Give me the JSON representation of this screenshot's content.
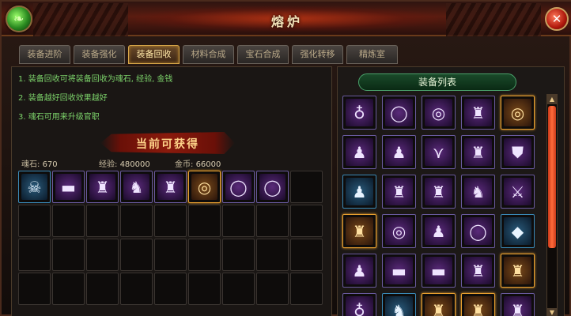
{
  "window": {
    "title": "熔炉",
    "close_label": "✕",
    "orb_glyph": "❧"
  },
  "tabs": [
    "装备进阶",
    "装备强化",
    "装备回收",
    "材料合成",
    "宝石合成",
    "强化转移",
    "精炼室"
  ],
  "active_tab": 2,
  "tips": [
    "1. 装备回收可将装备回收为魂石, 经验, 金钱",
    "2. 装备越好回收效果越好",
    "3. 魂石可用来升级官职"
  ],
  "banner": "当前可获得",
  "stats": {
    "soul": {
      "label": "魂石:",
      "value": "670"
    },
    "exp": {
      "label": "经验:",
      "value": "480000"
    },
    "gold": {
      "label": "金币:",
      "value": "66000"
    }
  },
  "recycle_items": [
    {
      "icon": "skull-necklace-icon",
      "glyph": "☠",
      "quality": "blue"
    },
    {
      "icon": "belt-icon",
      "glyph": "▬",
      "quality": "purple"
    },
    {
      "icon": "armor-icon",
      "glyph": "♜",
      "quality": "purple"
    },
    {
      "icon": "helmet-icon",
      "glyph": "♞",
      "quality": "purple"
    },
    {
      "icon": "armor-icon",
      "glyph": "♜",
      "quality": "purple"
    },
    {
      "icon": "ring-icon",
      "glyph": "◎",
      "quality": "gold"
    },
    {
      "icon": "bracelet-icon",
      "glyph": "◯",
      "quality": "purple"
    },
    {
      "icon": "bracelet-icon",
      "glyph": "◯",
      "quality": "purple"
    }
  ],
  "recycle_slots_total": 36,
  "list_title": "装备列表",
  "equipment_list": [
    {
      "icon": "necklace-icon",
      "glyph": "♁",
      "quality": "purple"
    },
    {
      "icon": "bracelet-icon",
      "glyph": "◯",
      "quality": "purple"
    },
    {
      "icon": "ring-icon",
      "glyph": "◎",
      "quality": "purple"
    },
    {
      "icon": "armor-icon",
      "glyph": "♜",
      "quality": "purple"
    },
    {
      "icon": "ring-icon",
      "glyph": "◎",
      "quality": "gold"
    },
    {
      "icon": "boots-icon",
      "glyph": "♟",
      "quality": "purple"
    },
    {
      "icon": "boots-icon",
      "glyph": "♟",
      "quality": "purple"
    },
    {
      "icon": "rank-badge-icon",
      "glyph": "⋎",
      "quality": "purple"
    },
    {
      "icon": "armor-icon",
      "glyph": "♜",
      "quality": "purple"
    },
    {
      "icon": "badge-icon",
      "glyph": "⛊",
      "quality": "purple"
    },
    {
      "icon": "boots-icon",
      "glyph": "♟",
      "quality": "blue"
    },
    {
      "icon": "armor-icon",
      "glyph": "♜",
      "quality": "purple"
    },
    {
      "icon": "armor-icon",
      "glyph": "♜",
      "quality": "purple"
    },
    {
      "icon": "helmet-icon",
      "glyph": "♞",
      "quality": "purple"
    },
    {
      "icon": "sword-icon",
      "glyph": "⚔",
      "quality": "purple"
    },
    {
      "icon": "armor-icon",
      "glyph": "♜",
      "quality": "gold"
    },
    {
      "icon": "ring-icon",
      "glyph": "◎",
      "quality": "purple"
    },
    {
      "icon": "boots-icon",
      "glyph": "♟",
      "quality": "purple"
    },
    {
      "icon": "bracelet-icon",
      "glyph": "◯",
      "quality": "purple"
    },
    {
      "icon": "gem-icon",
      "glyph": "◆",
      "quality": "blue"
    },
    {
      "icon": "boots-icon",
      "glyph": "♟",
      "quality": "purple"
    },
    {
      "icon": "belt-icon",
      "glyph": "▬",
      "quality": "purple"
    },
    {
      "icon": "belt-icon",
      "glyph": "▬",
      "quality": "purple"
    },
    {
      "icon": "armor-icon",
      "glyph": "♜",
      "quality": "purple"
    },
    {
      "icon": "armor-icon",
      "glyph": "♜",
      "quality": "gold"
    },
    {
      "icon": "necklace-icon",
      "glyph": "♁",
      "quality": "purple"
    },
    {
      "icon": "helmet-icon",
      "glyph": "♞",
      "quality": "blue"
    },
    {
      "icon": "armor-icon",
      "glyph": "♜",
      "quality": "gold"
    },
    {
      "icon": "armor-icon",
      "glyph": "♜",
      "quality": "gold"
    },
    {
      "icon": "armor-icon",
      "glyph": "♜",
      "quality": "purple"
    }
  ],
  "scrollbar": {
    "up": "▲",
    "down": "▼"
  },
  "colors": {
    "tip_text": "#7cd26a",
    "accent_gold": "#e8a030",
    "title_red": "#5a1c10"
  }
}
